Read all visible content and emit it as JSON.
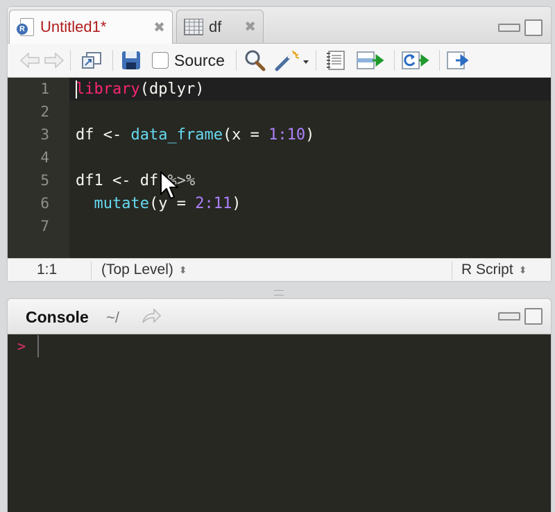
{
  "editor": {
    "tabs": [
      {
        "label": "Untitled1*",
        "close": "✖",
        "icon": "r-file-icon",
        "active": true
      },
      {
        "label": "df",
        "close": "✖",
        "icon": "data-grid-icon",
        "active": false
      }
    ],
    "toolbar": {
      "source_label": "Source",
      "icons": [
        "back-arrow-icon",
        "forward-arrow-icon",
        "show-in-window-icon",
        "save-icon",
        "search-icon",
        "wand-icon",
        "compile-notebook-icon",
        "run-line-icon",
        "rerun-icon",
        "source-file-icon"
      ]
    },
    "line_numbers": [
      "1",
      "2",
      "3",
      "4",
      "5",
      "6",
      "7"
    ],
    "code": {
      "l1_kw": "library",
      "l1_rest": "(dplyr)",
      "l3_a": "df <- ",
      "l3_fn": "data_frame",
      "l3_b": "(x = ",
      "l3_num": "1:10",
      "l3_c": ")",
      "l5_a": "df1 <- df ",
      "l5_pipe": "%>%",
      "l6_indent": "  ",
      "l6_fn": "mutate",
      "l6_b": "(y = ",
      "l6_num": "2:11",
      "l6_c": ")"
    },
    "status": {
      "position": "1:1",
      "scope": "(Top Level)",
      "file_type": "R Script",
      "updown": "⬍"
    }
  },
  "console": {
    "title": "Console",
    "path": "~/",
    "prompt": ">"
  },
  "colors": {
    "tab_active_text": "#b01b1b",
    "editor_bg": "#272822",
    "keyword": "#f92672",
    "function": "#66d9ef",
    "number": "#ae81ff",
    "prompt": "#e0306a"
  }
}
